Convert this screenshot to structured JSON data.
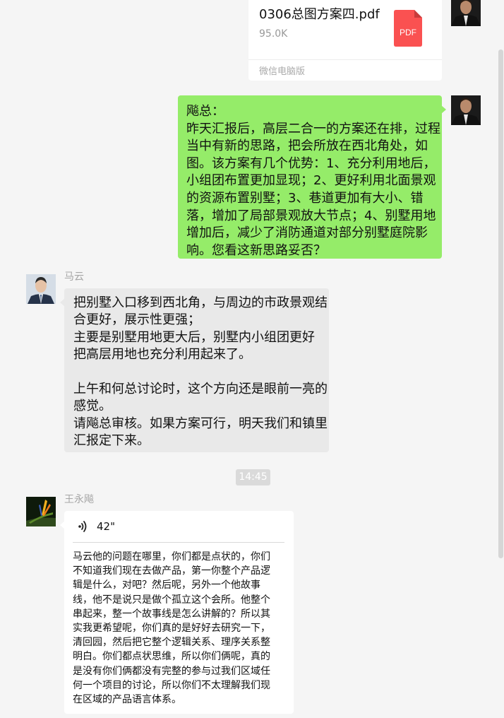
{
  "file_message": {
    "name": "0306总图方案四.pdf",
    "size": "95.0K",
    "source": "微信电脑版",
    "icon_label": "PDF"
  },
  "outgoing_message": {
    "lines": [
      "飚总：",
      "昨天汇报后，高层二合一的方案还在排，过程",
      "当中有新的思路，把会所放在西北角处，如",
      "图。该方案有几个优势：1、充分利用地后，",
      "小组团布置更加显现；2、更好利用北面景观",
      "的资源布置别墅；3、巷道更加有大小、错",
      "落，增加了局部景观放大节点；4、别墅用地",
      "增加后，减少了消防通道对部分别墅庭院影",
      "响。您看这新思路妥否？"
    ]
  },
  "mayun_message": {
    "sender": "马云",
    "lines": [
      "把别墅入口移到西北角，与周边的市政景观结",
      "合更好，展示性更强；",
      "主要是别墅用地更大后，别墅内小组团更好",
      "把高层用地也充分利用起来了。",
      "",
      "上午和何总讨论时，这个方向还是眼前一亮的",
      "感觉。",
      "请飚总审核。如果方案可行，明天我们和镇里",
      "汇报定下来。"
    ]
  },
  "timestamp": "14:45",
  "voice_message": {
    "sender": "王永飚",
    "duration": "42\"",
    "transcript_lines": [
      "马云他的问题在哪里，你们都是点状的，你们",
      "不知道我们现在去做产品，第一你整个产品逻",
      "辑是什么，对吧？然后呢，另外一个他故事",
      "线，他不是说只是做个孤立这个会所。他整个",
      "串起来，整一个故事线是怎么讲解的？所以其",
      "实我更希望呢，你们真的是好好去研究一下，",
      "清回园，然后把它整个逻辑关系、理序关系整",
      "明白。你们都点状思维，所以你们俩呢，真的",
      "是没有你们俩都没有完整的参与过我们区域任",
      "何一个项目的讨论，所以你们不太理解我们现",
      "在区域的产品语言体系。"
    ]
  },
  "colors": {
    "background": "#f5f5f5",
    "outgoing_bubble": "#95ec69",
    "incoming_bubble": "#e9e9e9",
    "pdf_red": "#fa5151",
    "name_gray": "#a6a6a6"
  }
}
